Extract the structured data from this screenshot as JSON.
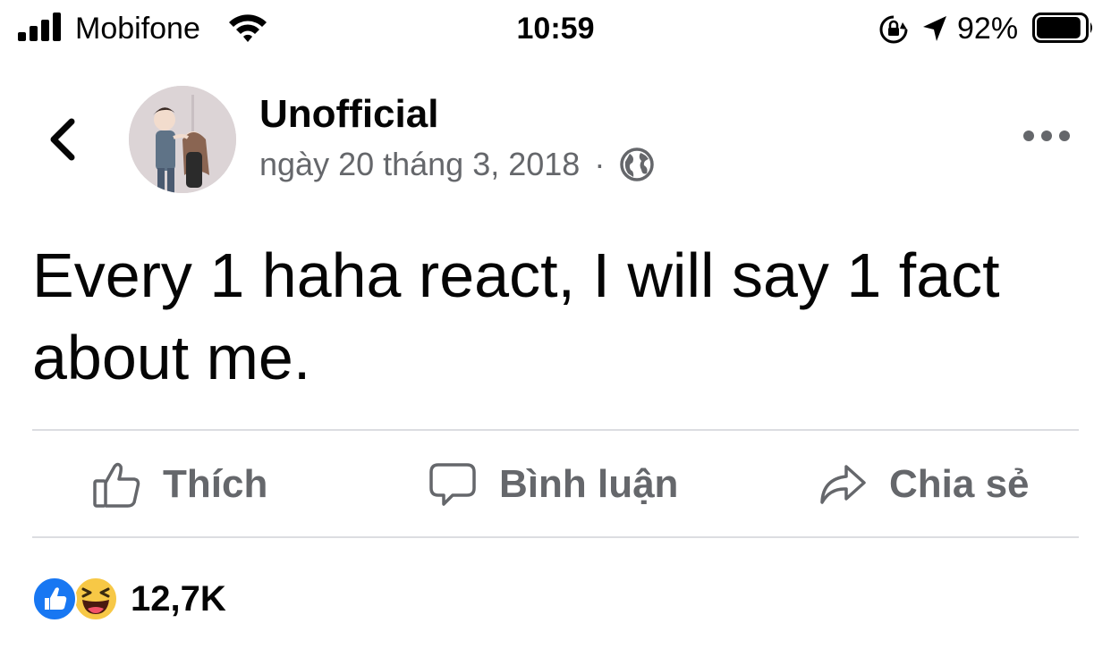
{
  "status_bar": {
    "carrier": "Mobifone",
    "time": "10:59",
    "battery_percent": "92%",
    "battery_level": 0.92,
    "icons": [
      "signal-icon",
      "wifi-icon",
      "rotation-lock-icon",
      "location-arrow-icon",
      "battery-icon"
    ]
  },
  "post": {
    "page_name": "Unofficial",
    "date": "ngày 20 tháng 3, 2018",
    "separator": "·",
    "privacy_icon": "globe-icon",
    "text": "Every 1 haha react, I will say 1 fact about me."
  },
  "actions": {
    "like": "Thích",
    "comment": "Bình luận",
    "share": "Chia sẻ"
  },
  "reactions": {
    "types": [
      "like",
      "haha"
    ],
    "count": "12,7K"
  },
  "colors": {
    "accent_blue": "#1877f2",
    "secondary_text": "#65676b",
    "divider": "#dcdde1",
    "haha_yellow": "#f7c846"
  }
}
